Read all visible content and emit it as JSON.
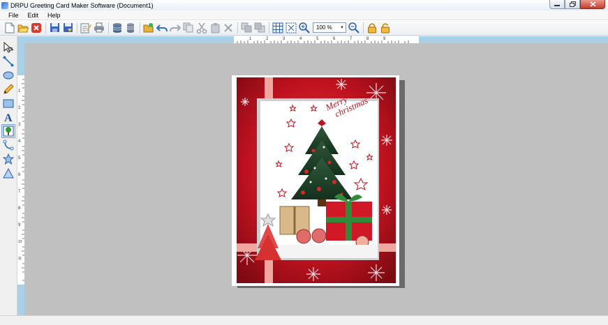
{
  "window": {
    "title": "DRPU Greeting Card Maker Software  (Document1)",
    "controls": [
      "minimize",
      "restore",
      "close"
    ]
  },
  "menu": {
    "items": [
      {
        "id": "file",
        "label": "File"
      },
      {
        "id": "edit",
        "label": "Edit"
      },
      {
        "id": "help",
        "label": "Help"
      }
    ]
  },
  "toolbar": {
    "buttons": [
      "new-icon",
      "open-icon",
      "close-doc-icon",
      "save-icon",
      "save-as-icon",
      "properties-icon",
      "print-icon",
      "database-icon",
      "database-series-icon",
      "folder-open-icon",
      "undo-icon",
      "redo-icon",
      "copy-style-icon",
      "cut-icon",
      "paste-icon",
      "delete-icon",
      "bring-front-icon",
      "send-back-icon",
      "grid-icon",
      "fit-icon",
      "zoom-in-icon",
      "zoom-out-icon",
      "lock-icon",
      "unlock-icon"
    ],
    "zoom_value": "100 %"
  },
  "tools": {
    "items": [
      "pointer-icon",
      "line-icon",
      "ellipse-icon",
      "pencil-icon",
      "rectangle-icon",
      "text-icon",
      "image-icon",
      "bezier-icon",
      "star-icon",
      "triangle-icon"
    ],
    "active": "image-icon"
  },
  "ruler": {
    "top_numbers": [
      "1",
      "2",
      "3",
      "4",
      "5",
      "6",
      "7",
      "8",
      "9"
    ],
    "left_numbers": [
      "1",
      "2",
      "3",
      "4",
      "5",
      "6",
      "7",
      "8",
      "9",
      "10",
      "11"
    ]
  },
  "card": {
    "greeting_line1": "Merry",
    "greeting_line2": "christmas"
  },
  "colors": {
    "canvas": "#c0c0c0",
    "ruler": "#a8d0e6",
    "card_red": "#c1121f",
    "ribbon": "#f2a6a0"
  }
}
